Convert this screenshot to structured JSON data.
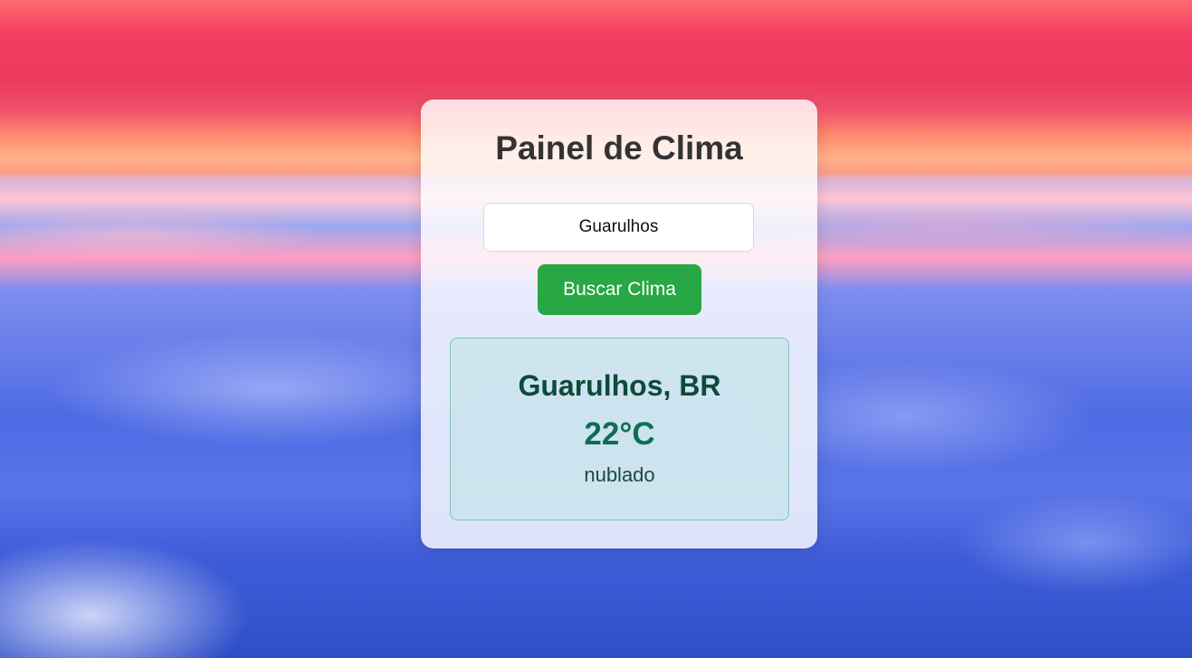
{
  "app": {
    "title": "Painel de Clima"
  },
  "search": {
    "value": "Guarulhos",
    "button_label": "Buscar Clima"
  },
  "result": {
    "location": "Guarulhos, BR",
    "temperature": "22°C",
    "description": "nublado"
  },
  "colors": {
    "button": "#28a745",
    "result_border": "#7ec9b2",
    "location_text": "#0e4a3a",
    "temperature_text": "#0d6e56"
  }
}
